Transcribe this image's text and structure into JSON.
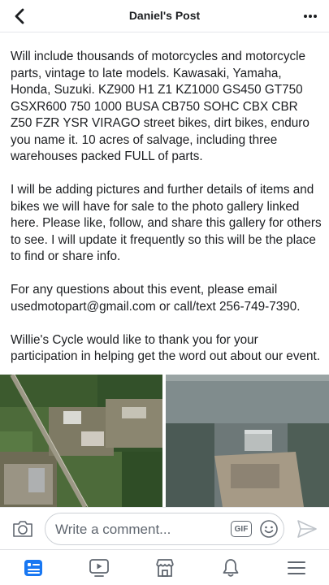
{
  "header": {
    "title": "Daniel's Post",
    "back_icon": "chevron-left-icon",
    "more_icon": "more-horizontal-icon"
  },
  "post": {
    "paragraphs": [
      "Will include thousands of motorcycles and motorcycle parts, vintage to late models. Kawasaki, Yamaha, Honda, Suzuki. KZ900 H1 Z1 KZ1000 GS450 GT750 GSXR600 750 1000 BUSA CB750 SOHC CBX CBR Z50 FZR YSR VIRAGO street bikes, dirt bikes, enduro you name it. 10 acres of salvage, including three warehouses packed FULL of parts.",
      "I will be adding pictures and further details of items and bikes we will have for sale to the photo gallery linked here. Please like, follow, and share this gallery for others to see. I will update it frequently so this will be the place to find or share info.",
      "For any questions about this event, please email usedmotopart@gmail.com or call/text 256-749-7390.",
      "Willie's Cycle would like to thank you for your participation in helping get the word out about our event."
    ]
  },
  "comment": {
    "placeholder": "Write a comment...",
    "gif_label": "GIF"
  },
  "tabs": [
    {
      "icon": "news-feed-icon",
      "active": true
    },
    {
      "icon": "watch-video-icon",
      "active": false
    },
    {
      "icon": "marketplace-icon",
      "active": false
    },
    {
      "icon": "notifications-bell-icon",
      "active": false
    },
    {
      "icon": "menu-icon",
      "active": false
    }
  ],
  "colors": {
    "accent": "#1877f2",
    "icon_gray": "#606770",
    "text": "#1c1e21"
  }
}
